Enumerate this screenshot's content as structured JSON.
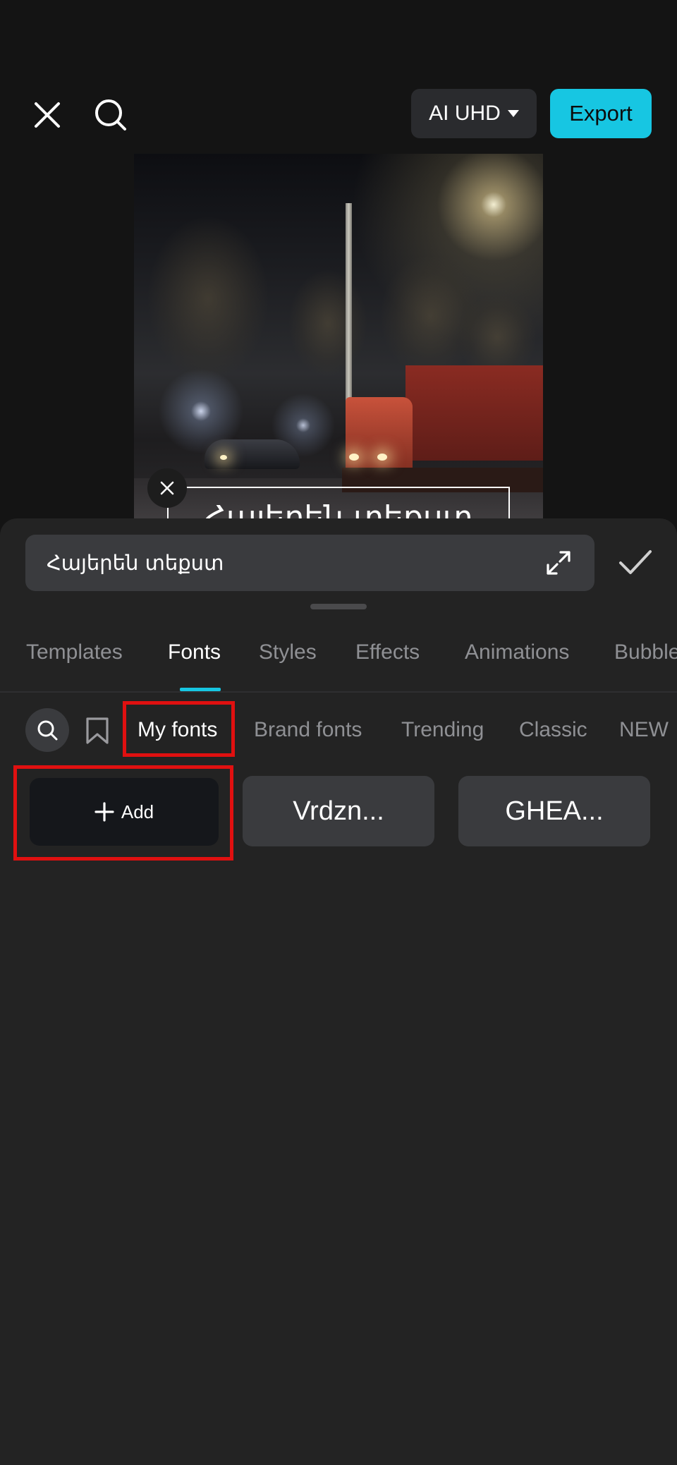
{
  "header": {
    "quality_label": "AI UHD",
    "export_label": "Export"
  },
  "preview": {
    "caption_text": "Հայերեն տեքստ"
  },
  "panel": {
    "text_value": "Հայերեն տեքստ",
    "tabs": [
      {
        "label": "Templates",
        "active": false
      },
      {
        "label": "Fonts",
        "active": true
      },
      {
        "label": "Styles",
        "active": false
      },
      {
        "label": "Effects",
        "active": false
      },
      {
        "label": "Animations",
        "active": false
      },
      {
        "label": "Bubble",
        "active": false
      }
    ],
    "font_categories": [
      {
        "label": "My fonts",
        "active": true
      },
      {
        "label": "Brand fonts",
        "active": false
      },
      {
        "label": "Trending",
        "active": false
      },
      {
        "label": "Classic",
        "active": false
      },
      {
        "label": "NEW",
        "active": false
      }
    ],
    "font_tiles": {
      "add_label": "Add",
      "items": [
        "Vrdzn...",
        "GHEA..."
      ]
    }
  },
  "colors": {
    "accent": "#17c6e2",
    "highlight": "#e01010",
    "panel_bg": "#232323"
  },
  "icons": [
    "close-icon",
    "search-icon",
    "caret-down-icon",
    "delete-icon",
    "expand-icon",
    "check-icon",
    "bookmark-icon",
    "plus-icon"
  ]
}
